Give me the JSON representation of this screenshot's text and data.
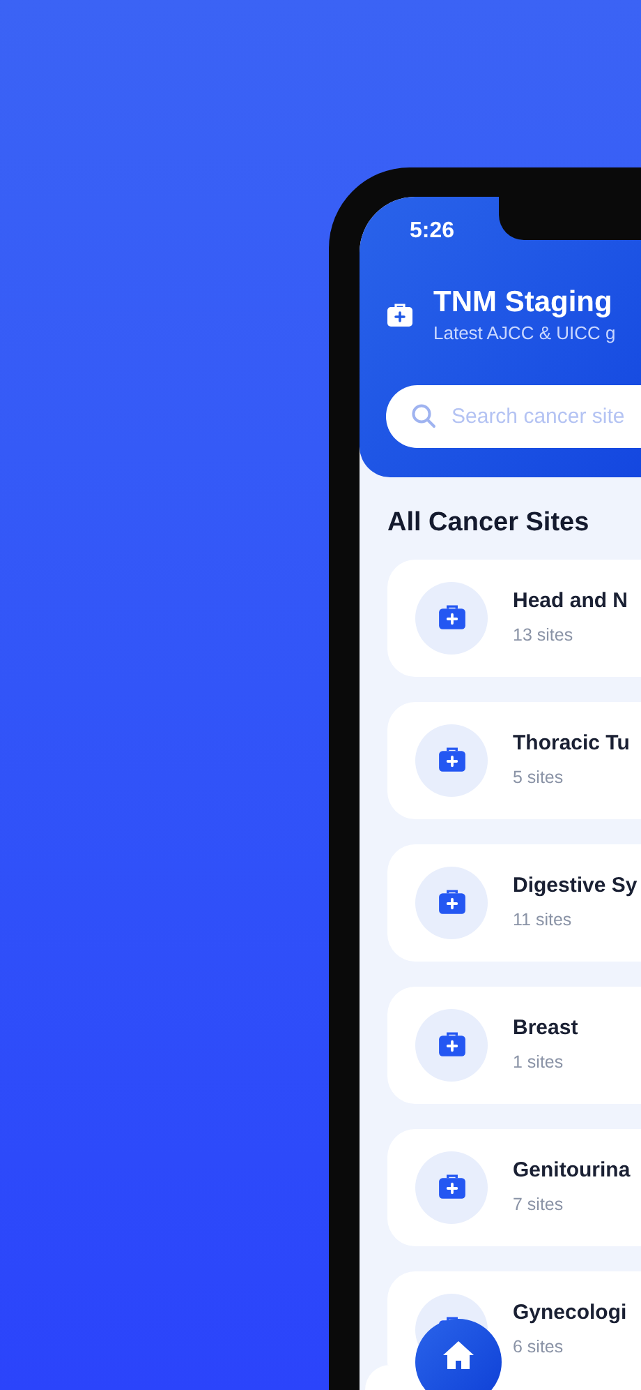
{
  "status_bar": {
    "time": "5:26"
  },
  "header": {
    "title": "TNM Staging",
    "subtitle": "Latest AJCC & UICC g"
  },
  "search": {
    "placeholder": "Search cancer site"
  },
  "section_title": "All Cancer Sites",
  "sites": [
    {
      "name": "Head and N",
      "count": "13 sites"
    },
    {
      "name": "Thoracic Tu",
      "count": "5 sites"
    },
    {
      "name": "Digestive Sy",
      "count": "11 sites"
    },
    {
      "name": "Breast",
      "count": "1 sites"
    },
    {
      "name": "Genitourina",
      "count": "7 sites"
    },
    {
      "name": "Gynecologi",
      "count": "6 sites"
    }
  ],
  "tab_bar": {
    "home": {
      "selected": true
    }
  }
}
